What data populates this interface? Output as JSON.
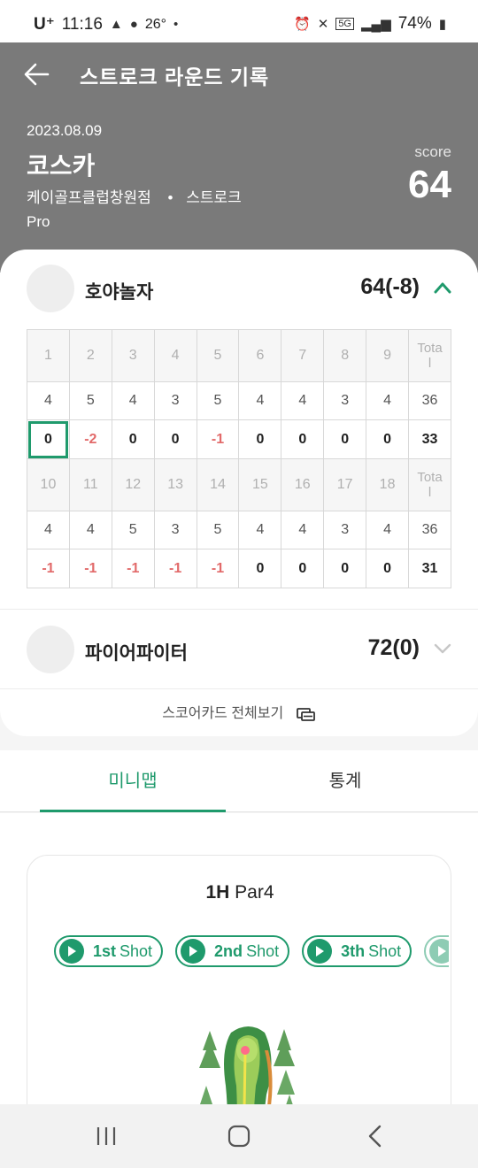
{
  "statusbar": {
    "carrier": "U⁺",
    "time": "11:16",
    "temperature": "26°",
    "battery": "74%",
    "icons": [
      "warning-icon",
      "message-icon",
      "alarm-icon",
      "mute-icon",
      "5g-icon",
      "signal-icon",
      "battery-icon"
    ]
  },
  "header": {
    "title": "스트로크 라운드 기록",
    "date": "2023.08.09",
    "course": "코스카",
    "venue": "케이골프클럽창원점",
    "separator": "•",
    "mode": "스트로크",
    "level": "Pro",
    "score_label": "score",
    "score_value": "64"
  },
  "players": [
    {
      "name": "호야놀자",
      "score": "64(-8)",
      "expanded": true,
      "front": {
        "holes": [
          "1",
          "2",
          "3",
          "4",
          "5",
          "6",
          "7",
          "8",
          "9",
          "Tota\nl"
        ],
        "par": [
          "4",
          "5",
          "4",
          "3",
          "5",
          "4",
          "4",
          "3",
          "4",
          "36"
        ],
        "scores": [
          "0",
          "-2",
          "0",
          "0",
          "-1",
          "0",
          "0",
          "0",
          "0",
          "33"
        ]
      },
      "back": {
        "holes": [
          "10",
          "11",
          "12",
          "13",
          "14",
          "15",
          "16",
          "17",
          "18",
          "Tota\nl"
        ],
        "par": [
          "4",
          "4",
          "5",
          "3",
          "5",
          "4",
          "4",
          "3",
          "4",
          "36"
        ],
        "scores": [
          "-1",
          "-1",
          "-1",
          "-1",
          "-1",
          "0",
          "0",
          "0",
          "0",
          "31"
        ]
      }
    },
    {
      "name": "파이어파이터",
      "score": "72(0)",
      "expanded": false
    }
  ],
  "scorecard_link": "스코어카드 전체보기",
  "tabs": [
    {
      "label": "미니맵",
      "active": true
    },
    {
      "label": "통계",
      "active": false
    }
  ],
  "minimap": {
    "hole": "1H",
    "par": "Par4",
    "shots": [
      {
        "num": "1st",
        "label": "Shot"
      },
      {
        "num": "2nd",
        "label": "Shot"
      },
      {
        "num": "3th",
        "label": "Shot"
      }
    ]
  },
  "colors": {
    "accent": "#1f9a6c",
    "header_bg": "#7a7a7a",
    "negative": "#e26a6a"
  }
}
